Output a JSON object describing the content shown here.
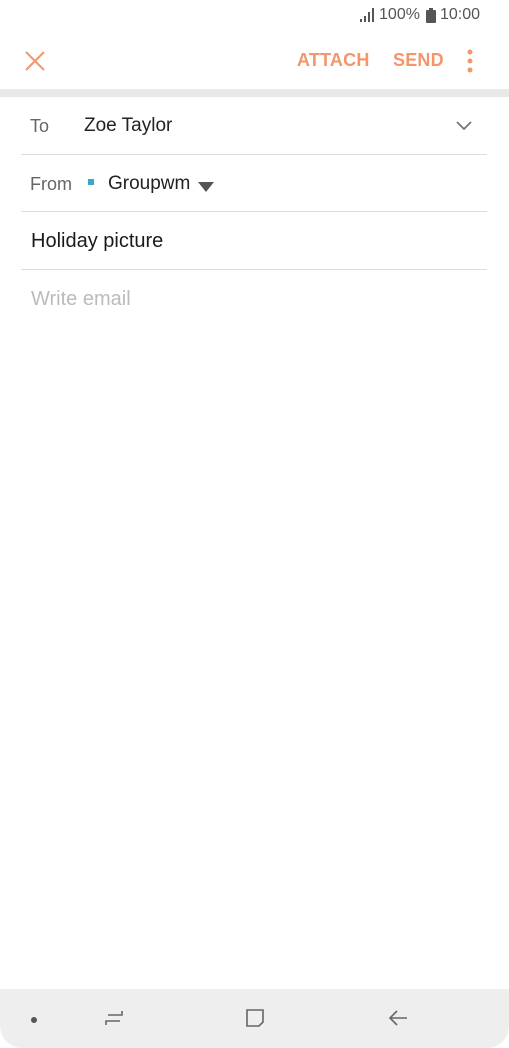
{
  "status_bar": {
    "battery": "100%",
    "time": "10:00",
    "signal_icon": "signal-icon",
    "battery_icon": "battery-icon"
  },
  "app_bar": {
    "close_icon": "close-icon",
    "attach_label": "ATTACH",
    "send_label": "SEND",
    "more_icon": "more-vertical-icon",
    "accent_color": "#f5956a"
  },
  "compose": {
    "to_label": "To",
    "to_value": "Zoe Taylor",
    "from_label": "From",
    "from_value": "Groupwm",
    "account_color": "#3aa9c8",
    "subject": "Holiday picture",
    "body_placeholder": "Write email"
  },
  "nav_bar": {
    "recent_icon": "recent-apps-icon",
    "home_icon": "home-icon",
    "back_icon": "back-icon"
  }
}
